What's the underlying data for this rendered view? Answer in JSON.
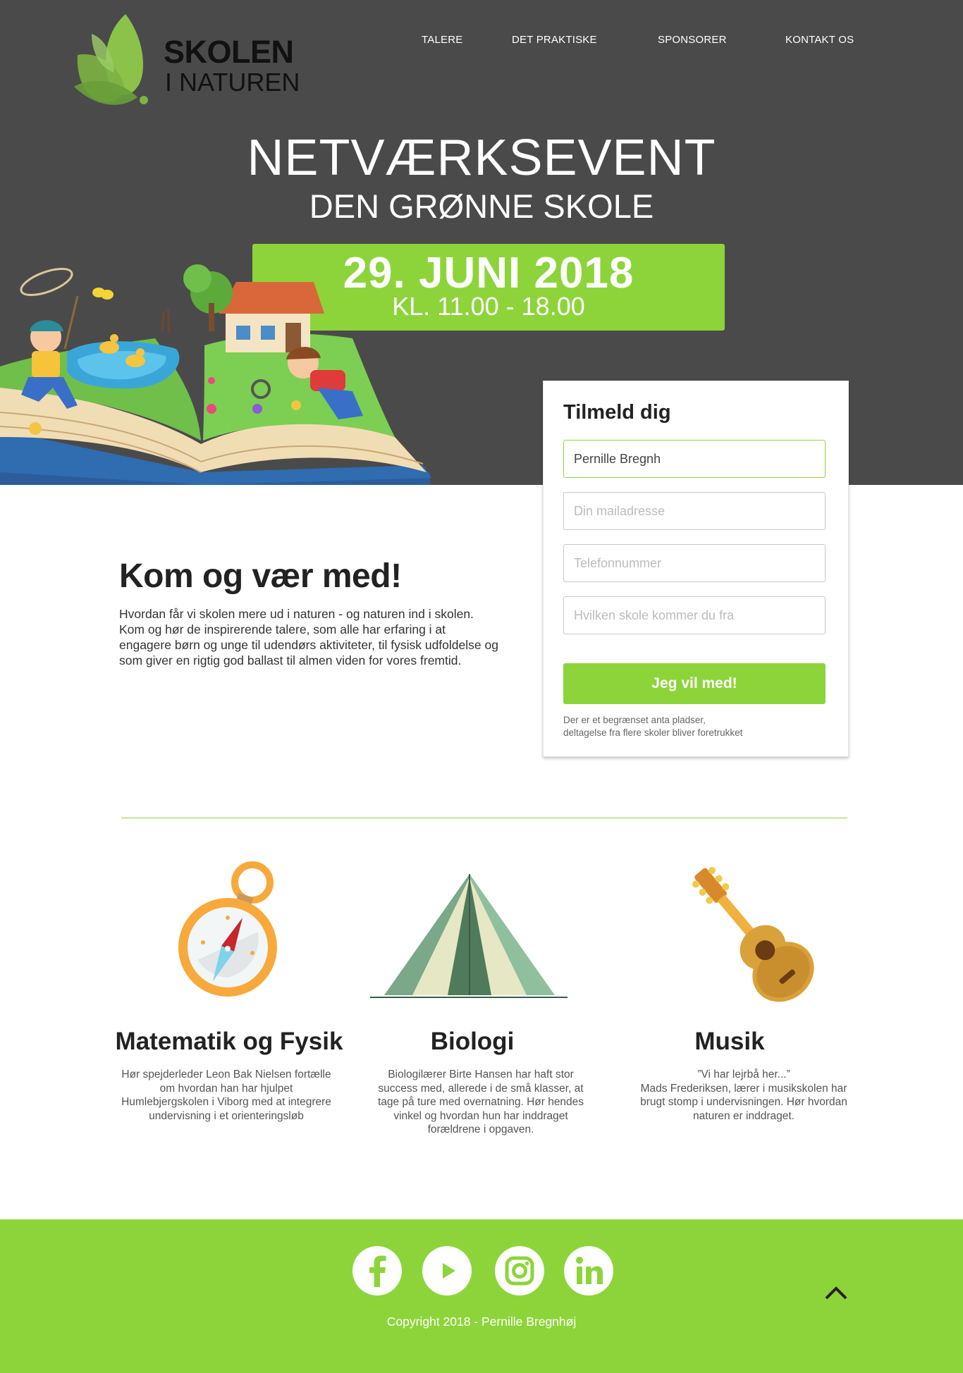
{
  "logo": {
    "line1": "SKOLEN",
    "line2": "I NATUREN"
  },
  "nav": {
    "items": [
      "TALERE",
      "DET PRAKTISKE",
      "SPONSORER",
      "KONTAKT OS"
    ]
  },
  "hero": {
    "title": "NETVÆRKSEVENT",
    "subtitle": "DEN GRØNNE SKOLE",
    "date": "29. JUNI 2018",
    "time": "KL. 11.00 - 18.00"
  },
  "form": {
    "heading": "Tilmeld dig",
    "name_value": "Pernille Bregnh",
    "email_placeholder": "Din mailadresse",
    "phone_placeholder": "Telefonnummer",
    "school_placeholder": "Hvilken skole kommer du fra",
    "submit_label": "Jeg vil med!",
    "note_line1": "Der er et begrænset anta pladser,",
    "note_line2": "deltagelse fra flere skoler bliver foretrukket"
  },
  "intro": {
    "heading": "Kom og vær med!",
    "text": "Hvordan får vi skolen mere ud i naturen - og naturen ind i skolen. Kom og hør de inspirerende talere, som alle har erfaring i at engagere børn og unge til udendørs aktiviteter, til fysisk udfoldelse og som giver en rigtig god ballast til almen viden for vores fremtid."
  },
  "topics": [
    {
      "icon": "compass-icon",
      "title": "Matematik og Fysik",
      "text": "Hør spejderleder Leon Bak Nielsen fortælle om hvordan han har hjulpet Humlebjergskolen i Viborg med at integrere undervisning i et orienteringsløb"
    },
    {
      "icon": "tent-icon",
      "title": "Biologi",
      "text": "Biologilærer Birte Hansen har haft stor success med, allerede i de små klasser, at tage på ture med overnatning. Hør hendes vinkel og hvordan hun har inddraget forældrene i opgaven."
    },
    {
      "icon": "guitar-icon",
      "title": "Musik",
      "text_quote": "”Vi har lejrbå her...”",
      "text": "Mads Frederiksen, lærer i musikskolen har brugt stomp i undervisningen. Hør hvordan naturen er inddraget."
    }
  ],
  "footer": {
    "social": [
      "facebook-icon",
      "youtube-icon",
      "instagram-icon",
      "linkedin-icon"
    ],
    "copyright": "Copyright 2018 - Pernille Bregnhøj"
  },
  "colors": {
    "accent": "#8dd43a",
    "hero_bg": "#4a4a4a"
  }
}
